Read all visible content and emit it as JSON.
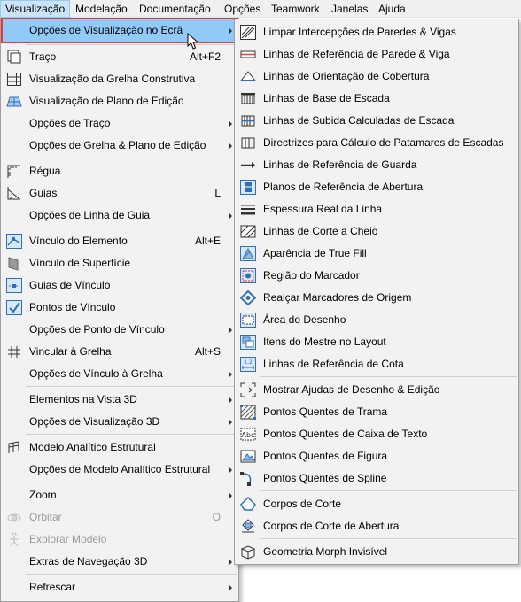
{
  "menubar": {
    "items": [
      "Visualização",
      "Modelação",
      "Documentação",
      "Opções",
      "Teamwork",
      "Janelas",
      "Ajuda"
    ]
  },
  "main_menu": {
    "items": [
      {
        "label": "Opções de Visualização no Ecrã",
        "submenu": true,
        "icon": "none",
        "selected": true
      },
      {
        "label": "Traço",
        "shortcut": "Alt+F2",
        "icon": "trace-icon"
      },
      {
        "label": "Visualização da Grelha Construtiva",
        "icon": "grid-icon"
      },
      {
        "label": "Visualização de Plano de Edição",
        "icon": "edit-plane-icon"
      },
      {
        "label": "Opções de Traço",
        "submenu": true
      },
      {
        "label": "Opções de Grelha & Plano de Edição",
        "submenu": true
      },
      {
        "label": "Régua",
        "icon": "ruler-icon"
      },
      {
        "label": "Guias",
        "shortcut": "L",
        "icon": "guides-icon"
      },
      {
        "label": "Opções de Linha de Guia",
        "submenu": true
      },
      {
        "label": "Vínculo do Elemento",
        "shortcut": "Alt+E",
        "icon": "element-snap-icon"
      },
      {
        "label": "Vínculo de Superfície",
        "icon": "surface-snap-icon"
      },
      {
        "label": "Guias de Vínculo",
        "icon": "snap-guides-icon"
      },
      {
        "label": "Pontos de Vínculo",
        "icon": "snap-points-icon"
      },
      {
        "label": "Opções de Ponto de Vínculo",
        "submenu": true
      },
      {
        "label": "Vincular à Grelha",
        "shortcut": "Alt+S",
        "icon": "snap-grid-icon"
      },
      {
        "label": "Opções de Vínculo à Grelha",
        "submenu": true
      },
      {
        "label": "Elementos na Vista 3D",
        "submenu": true
      },
      {
        "label": "Opções de Visualização 3D",
        "submenu": true
      },
      {
        "label": "Modelo Analítico Estrutural",
        "icon": "structural-model-icon"
      },
      {
        "label": "Opções de Modelo Analítico Estrutural",
        "submenu": true
      },
      {
        "label": "Zoom",
        "submenu": true
      },
      {
        "label": "Orbitar",
        "shortcut": "O",
        "icon": "orbit-icon",
        "disabled": true
      },
      {
        "label": "Explorar Modelo",
        "icon": "explore-icon",
        "disabled": true
      },
      {
        "label": "Extras de Navegação 3D",
        "submenu": true
      },
      {
        "label": "Refrescar",
        "submenu": true
      }
    ]
  },
  "sub_menu": {
    "items": [
      {
        "label": "Limpar Intercepções de Paredes & Vigas",
        "icon": "wall-clean-icon"
      },
      {
        "label": "Linhas de Referência de Parede & Viga",
        "icon": "wall-ref-line-icon"
      },
      {
        "label": "Linhas de Orientação de Cobertura",
        "icon": "roof-pivot-icon"
      },
      {
        "label": "Linhas de Base de Escada",
        "icon": "stair-baseline-icon"
      },
      {
        "label": "Linhas de Subida Calculadas de Escada",
        "icon": "stair-walkline-icon"
      },
      {
        "label": "Directrizes para Cálculo de Patamares de Escadas",
        "icon": "stair-guide-icon"
      },
      {
        "label": "Linhas de Referência de Guarda",
        "icon": "railing-ref-icon"
      },
      {
        "label": "Planos de Referência de Abertura",
        "icon": "opening-plane-icon"
      },
      {
        "label": "Espessura Real da Linha",
        "icon": "line-weight-icon"
      },
      {
        "label": "Linhas de Corte a Cheio",
        "icon": "cut-fill-icon"
      },
      {
        "label": "Aparência de True Fill",
        "icon": "true-fill-icon"
      },
      {
        "label": "Região do Marcador",
        "icon": "marker-region-icon"
      },
      {
        "label": "Realçar Marcadores de Origem",
        "icon": "source-marker-icon"
      },
      {
        "label": "Área do Desenho",
        "icon": "drawing-frame-icon"
      },
      {
        "label": "Itens do Mestre no Layout",
        "icon": "master-items-icon"
      },
      {
        "label": "Linhas de Referência de Cota",
        "icon": "dimension-ref-icon"
      },
      {
        "label": "Mostrar Ajudas de Desenho & Edição",
        "icon": "editing-aids-icon"
      },
      {
        "label": "Pontos Quentes de Trama",
        "icon": "hatch-hotspot-icon"
      },
      {
        "label": "Pontos Quentes de Caixa de Texto",
        "icon": "text-hotspot-icon"
      },
      {
        "label": "Pontos Quentes de Figura",
        "icon": "figure-hotspot-icon"
      },
      {
        "label": "Pontos Quentes de Spline",
        "icon": "spline-hotspot-icon"
      },
      {
        "label": "Corpos de Corte",
        "icon": "cut-body-icon"
      },
      {
        "label": "Corpos de Corte de Abertura",
        "icon": "opening-cut-body-icon"
      },
      {
        "label": "Geometria Morph Invisível",
        "icon": "morph-hidden-icon"
      }
    ]
  },
  "colors": {
    "selection": "#91c9f7",
    "highlight_box": "#e23b3b",
    "menu_bg": "#f2f2f2",
    "icon_blue": "#2f6fb6"
  }
}
